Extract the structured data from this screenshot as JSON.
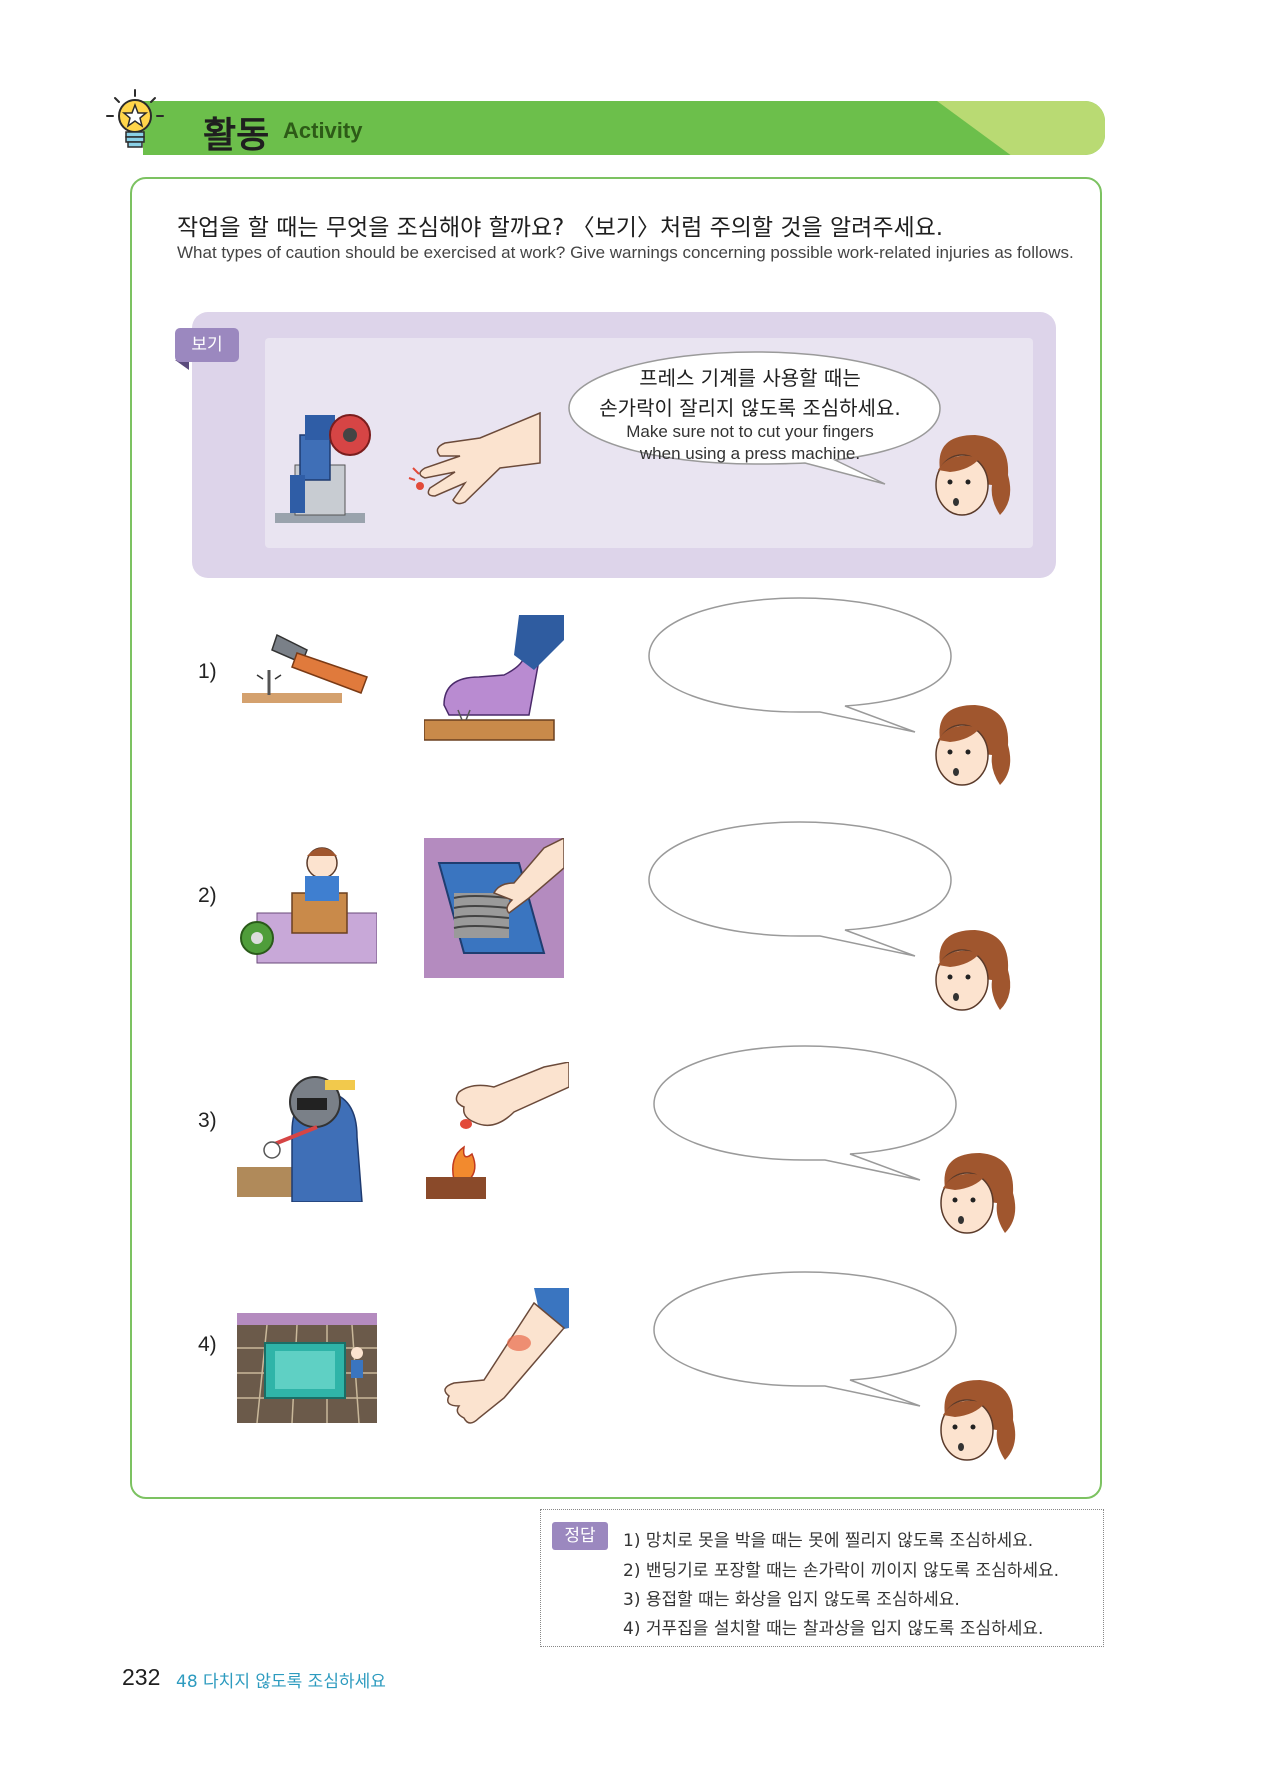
{
  "header": {
    "title_ko": "활동",
    "title_en": "Activity"
  },
  "question": {
    "ko": "작업을 할 때는 무엇을 조심해야 할까요? 〈보기〉처럼 주의할 것을 알려주세요.",
    "en": "What types of caution should be exercised at work? Give warnings concerning possible work-related injuries as follows."
  },
  "example": {
    "label": "보기",
    "speech_ko_1": "프레스 기계를 사용할 때는",
    "speech_ko_2": "손가락이 잘리지 않도록 조심하세요.",
    "speech_en_1": "Make sure not to cut your fingers",
    "speech_en_2": "when using a press machine."
  },
  "items": [
    {
      "number": "1)"
    },
    {
      "number": "2)"
    },
    {
      "number": "3)"
    },
    {
      "number": "4)"
    }
  ],
  "answer": {
    "label": "정답",
    "lines": [
      "1) 망치로 못을 박을 때는 못에 찔리지 않도록 조심하세요.",
      "2) 밴딩기로 포장할 때는 손가락이 끼이지 않도록 조심하세요.",
      "3) 용접할 때는 화상을 입지 않도록 조심하세요.",
      "4) 거푸집을 설치할 때는 찰과상을 입지 않도록 조심하세요."
    ]
  },
  "footer": {
    "page_number": "232",
    "chapter": "48 다치지 않도록 조심하세요"
  },
  "colors": {
    "banner_green": "#6cbf4b",
    "banner_light": "#b9da73",
    "frame_green": "#7cc261",
    "example_purple": "#ddd4ea",
    "label_purple": "#9b88bf",
    "chapter_blue": "#2d9bbf"
  }
}
